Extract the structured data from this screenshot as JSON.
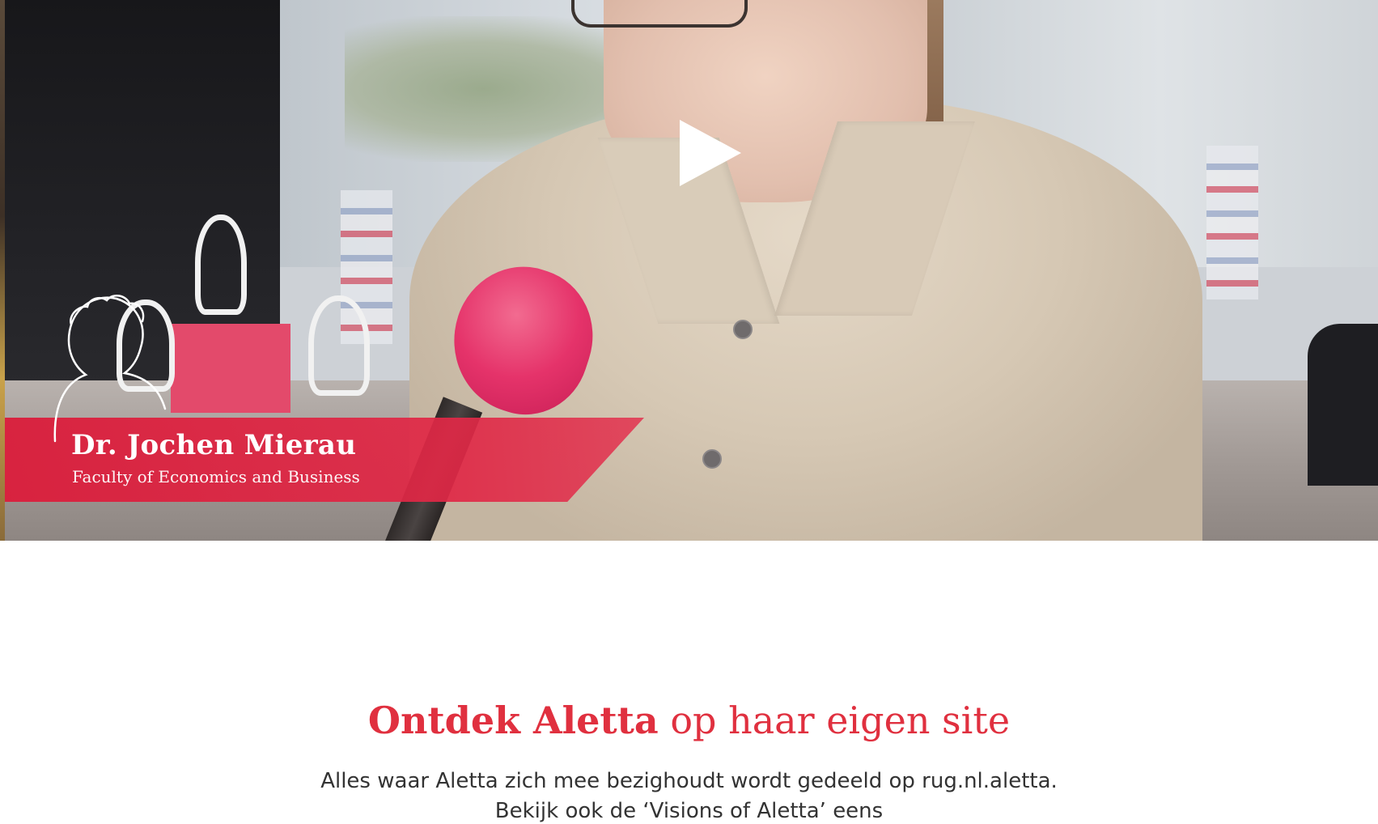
{
  "video": {
    "speaker_name": "Dr. Jochen Mierau",
    "speaker_role": "Faculty of Economics and Business",
    "play_icon": "play-icon",
    "accent_color": "#e0303f"
  },
  "section": {
    "headline_bold": "Ontdek Aletta",
    "headline_rest": "op haar eigen site",
    "intro_line1": "Alles waar Aletta zich mee bezighoudt wordt gedeeld op rug.nl.aletta.",
    "intro_line2": "Bekijk ook de ‘Visions of Aletta’ eens"
  }
}
